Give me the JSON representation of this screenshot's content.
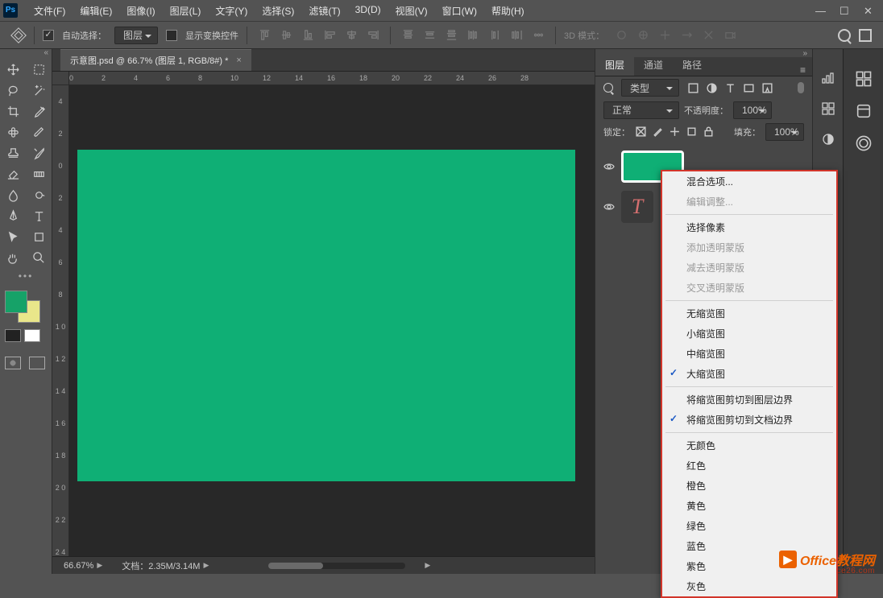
{
  "menu": [
    "文件(F)",
    "编辑(E)",
    "图像(I)",
    "图层(L)",
    "文字(Y)",
    "选择(S)",
    "滤镜(T)",
    "3D(D)",
    "视图(V)",
    "窗口(W)",
    "帮助(H)"
  ],
  "options": {
    "auto_select_label": "自动选择：",
    "auto_select_type": "图层",
    "show_transform_label": "显示变换控件",
    "mode3d_label": "3D 模式："
  },
  "document_tab": "示意图.psd @ 66.7% (图层 1, RGB/8#) *",
  "ruler_h": [
    "0",
    "2",
    "4",
    "6",
    "8",
    "10",
    "12",
    "14",
    "16",
    "18",
    "20",
    "22",
    "24",
    "26",
    "28"
  ],
  "ruler_v": [
    "4",
    "2",
    "0",
    "2",
    "4",
    "6",
    "8",
    "1 0",
    "1 2",
    "1 4",
    "1 6",
    "1 8",
    "2 0",
    "2 2",
    "2 4"
  ],
  "status": {
    "zoom": "66.67%",
    "doc": "文档：2.35M/3.14M"
  },
  "panels": {
    "tabs": [
      "图层",
      "通道",
      "路径"
    ],
    "kind_label": "类型",
    "blend_mode": "正常",
    "opacity_label": "不透明度：",
    "opacity_val": "100%",
    "lock_label": "锁定：",
    "fill_label": "填充：",
    "fill_val": "100%"
  },
  "context_menu": [
    {
      "type": "item",
      "label": "混合选项..."
    },
    {
      "type": "item",
      "label": "编辑调整...",
      "disabled": true
    },
    {
      "type": "sep"
    },
    {
      "type": "item",
      "label": "选择像素"
    },
    {
      "type": "item",
      "label": "添加透明蒙版",
      "disabled": true
    },
    {
      "type": "item",
      "label": "减去透明蒙版",
      "disabled": true
    },
    {
      "type": "item",
      "label": "交叉透明蒙版",
      "disabled": true
    },
    {
      "type": "sep"
    },
    {
      "type": "item",
      "label": "无缩览图"
    },
    {
      "type": "item",
      "label": "小缩览图"
    },
    {
      "type": "item",
      "label": "中缩览图"
    },
    {
      "type": "item",
      "label": "大缩览图",
      "checked": true
    },
    {
      "type": "sep"
    },
    {
      "type": "item",
      "label": "将缩览图剪切到图层边界"
    },
    {
      "type": "item",
      "label": "将缩览图剪切到文档边界",
      "checked": true
    },
    {
      "type": "sep"
    },
    {
      "type": "item",
      "label": "无颜色"
    },
    {
      "type": "item",
      "label": "红色"
    },
    {
      "type": "item",
      "label": "橙色"
    },
    {
      "type": "item",
      "label": "黄色"
    },
    {
      "type": "item",
      "label": "绿色"
    },
    {
      "type": "item",
      "label": "蓝色"
    },
    {
      "type": "item",
      "label": "紫色"
    },
    {
      "type": "item",
      "label": "灰色"
    }
  ],
  "colors": {
    "artboard": "#0FAF75",
    "fg": "#16a268",
    "bg": "#e9e68a",
    "accent": "#eb6100"
  },
  "watermark": {
    "title": "Office教程网",
    "sub": "www.office26.com"
  }
}
